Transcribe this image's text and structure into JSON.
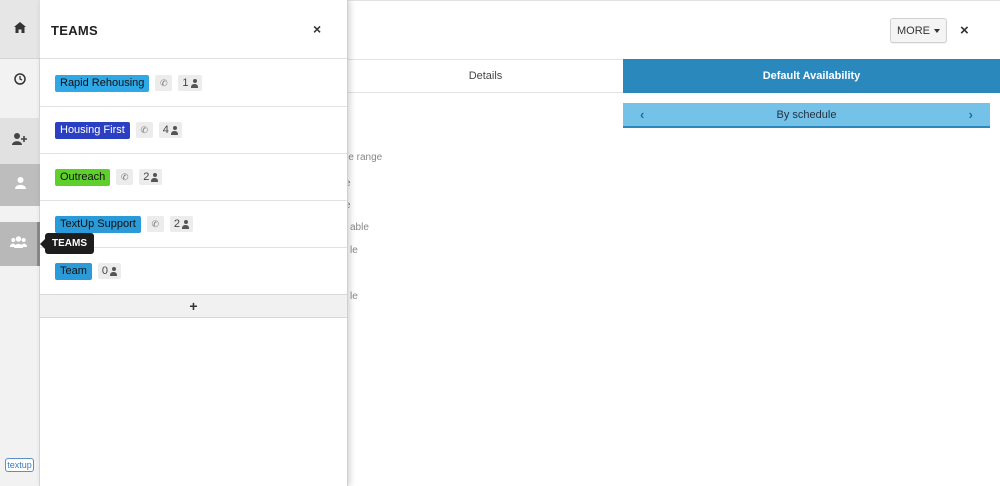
{
  "rail": {
    "items": [
      {
        "icon": "home-icon"
      },
      {
        "icon": "clock-icon"
      },
      {
        "icon": "add-user-icon"
      },
      {
        "icon": "user-icon"
      },
      {
        "icon": "teams-icon"
      }
    ],
    "logo": "textup",
    "tooltip": "TEAMS"
  },
  "panel": {
    "title": "TEAMS",
    "close": "×",
    "teams": [
      {
        "name": "Rapid Rehousing",
        "color": "#2ea8e6",
        "count": "1"
      },
      {
        "name": "Housing First",
        "color": "#2b3fc2",
        "text_color": "#ffffff",
        "count": "4"
      },
      {
        "name": "Outreach",
        "color": "#5fcf2c",
        "count": "2"
      },
      {
        "name": "TextUp Support",
        "color": "#2b9ad8",
        "count": "2"
      },
      {
        "name": "Team",
        "color": "#2b9ad8",
        "count": "0"
      }
    ],
    "add_label": "+"
  },
  "main": {
    "more_label": "MORE",
    "close": "×",
    "tabs": {
      "details": "Details",
      "default_availability": "Default Availability"
    },
    "schedule": {
      "label": "By schedule",
      "prev": "‹",
      "next": "›"
    },
    "fragments": [
      "me range",
      "e",
      "e",
      "able",
      "le",
      "le"
    ]
  }
}
